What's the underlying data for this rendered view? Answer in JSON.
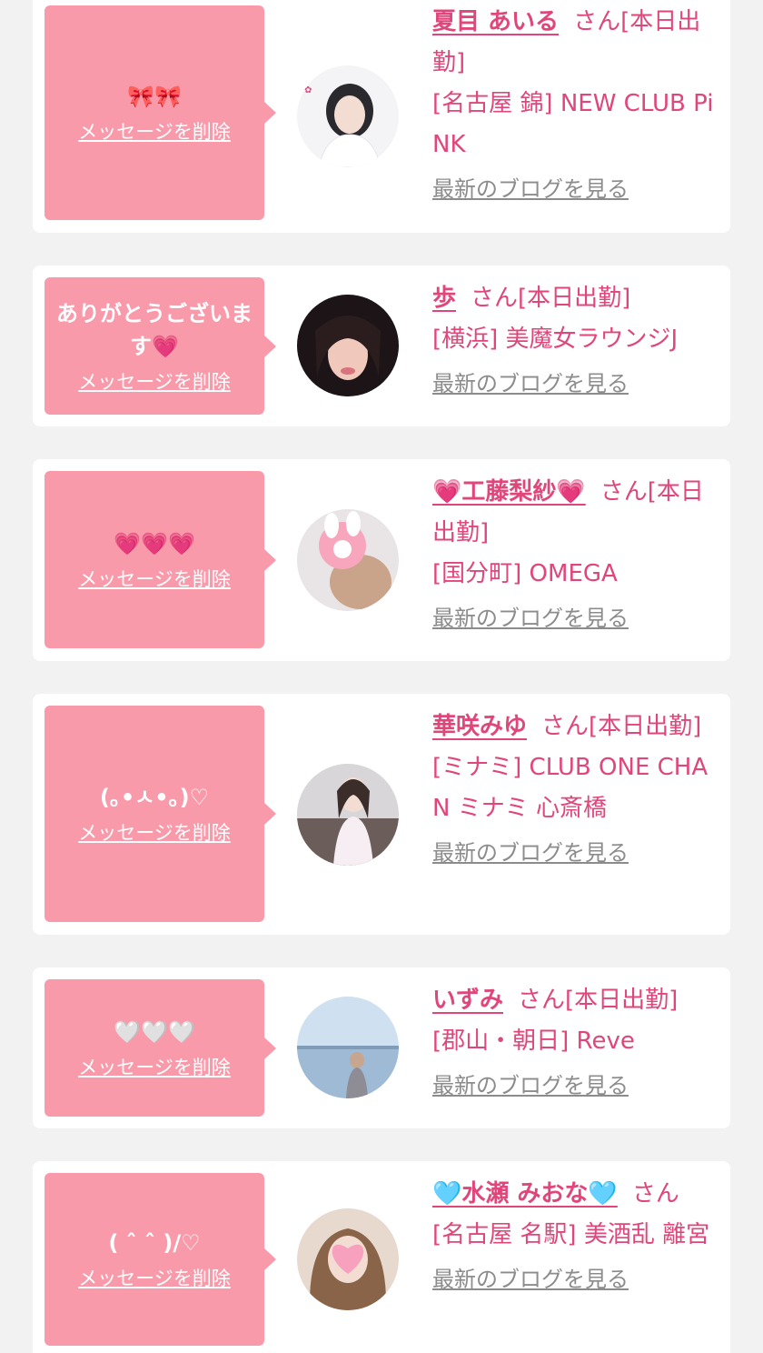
{
  "delete_label": "メッセージを削除",
  "blog_label": "最新のブログを見る",
  "san_label": "さん",
  "colors": {
    "bubble": "#f99aab",
    "accent": "#e0467a",
    "link_gray": "#8c8c8c",
    "background": "#f2f2f2"
  },
  "items": [
    {
      "message": "🎀🎀",
      "name": "夏目 あいる",
      "status": "[本日出勤]",
      "shop": "[名古屋 錦] NEW CLUB PiNK",
      "avatar_icon": "avatar-photo"
    },
    {
      "message": "ありがとうございます💗",
      "name": "歩",
      "status": "[本日出勤]",
      "shop": "[横浜] 美魔女ラウンジJ",
      "avatar_icon": "avatar-photo"
    },
    {
      "message": "💗💗💗",
      "name": "💗工藤梨紗💗",
      "status": "[本日出勤]",
      "shop": "[国分町] OMEGA",
      "avatar_icon": "avatar-photo"
    },
    {
      "message": "(｡•ㅅ•｡)♡",
      "name": "華咲みゆ",
      "status": "[本日出勤]",
      "shop": "[ミナミ] CLUB ONE CHAN ミナミ 心斎橋",
      "avatar_icon": "avatar-photo"
    },
    {
      "message": "🤍🤍🤍",
      "name": "いずみ",
      "status": "[本日出勤]",
      "shop": "[郡山・朝日] Reve",
      "avatar_icon": "avatar-photo"
    },
    {
      "message": "( ˆ ˆ )/♡",
      "name": "🩵水瀬 みおな🩵",
      "status": "",
      "shop": "[名古屋 名駅] 美酒乱 離宮",
      "avatar_icon": "avatar-photo"
    }
  ]
}
